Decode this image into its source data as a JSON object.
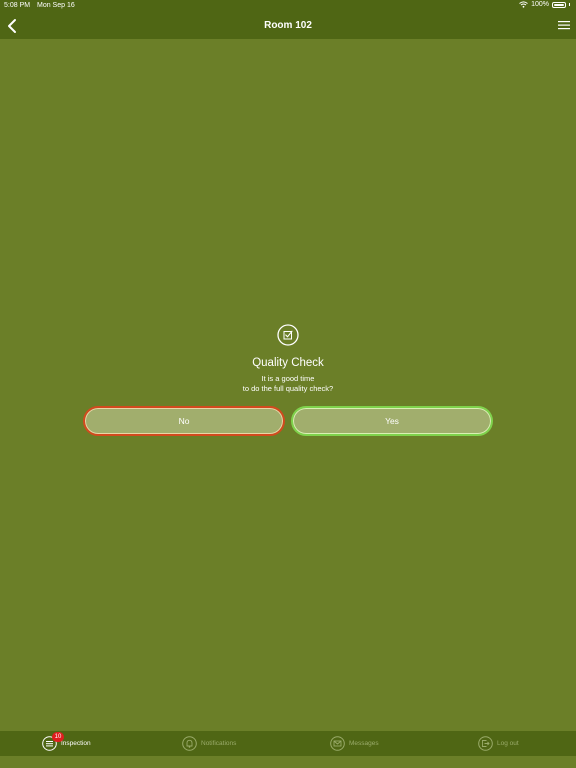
{
  "status_bar": {
    "time": "5:08 PM",
    "date": "Mon Sep 16",
    "battery": "100%"
  },
  "header": {
    "title": "Room 102"
  },
  "dialog": {
    "title": "Quality Check",
    "message_line1": "It is a good time",
    "message_line2": "to do the full quality check?",
    "no_label": "No",
    "yes_label": "Yes"
  },
  "tabbar": {
    "inspection": {
      "label": "Inspection",
      "badge": "10"
    },
    "notifications": {
      "label": "Notifications"
    },
    "messages": {
      "label": "Messages"
    },
    "logout": {
      "label": "Log out"
    }
  },
  "colors": {
    "background": "#6b7f28",
    "bar": "#4f6614",
    "button_fill": "#a1ae6d",
    "no_border": "#d24a1e",
    "yes_border": "#7fd24c",
    "badge": "#e01e1e"
  },
  "icons": [
    "back-chevron-icon",
    "menu-icon",
    "checkbox-edit-icon",
    "list-icon",
    "bell-icon",
    "envelope-icon",
    "logout-icon",
    "wifi-icon",
    "battery-icon"
  ]
}
